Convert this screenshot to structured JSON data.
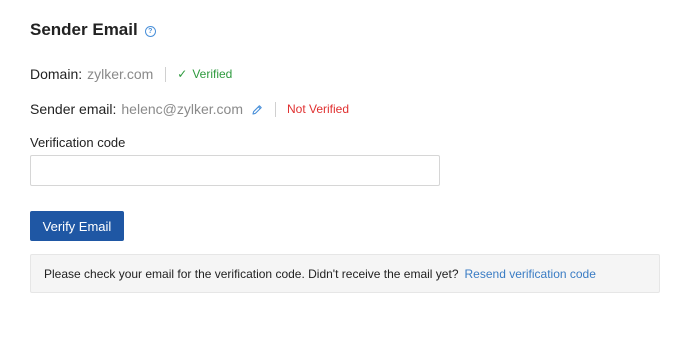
{
  "header": {
    "title": "Sender Email",
    "help_icon": "?"
  },
  "domain": {
    "label": "Domain:",
    "value": "zylker.com",
    "status": "Verified",
    "status_icon": "✓",
    "status_color": "#2e9a3e"
  },
  "sender": {
    "label": "Sender email:",
    "value": "helenc@zylker.com",
    "edit_icon": "pencil-icon",
    "status": "Not Verified",
    "status_color": "#e03030"
  },
  "verification": {
    "label": "Verification code",
    "value": "",
    "placeholder": ""
  },
  "actions": {
    "verify_label": "Verify Email",
    "accent_color": "#1f57a4"
  },
  "notice": {
    "message": "Please check your email for the verification code. Didn't receive the email yet?",
    "resend_label": "Resend verification code",
    "link_color": "#3a7cc4"
  }
}
